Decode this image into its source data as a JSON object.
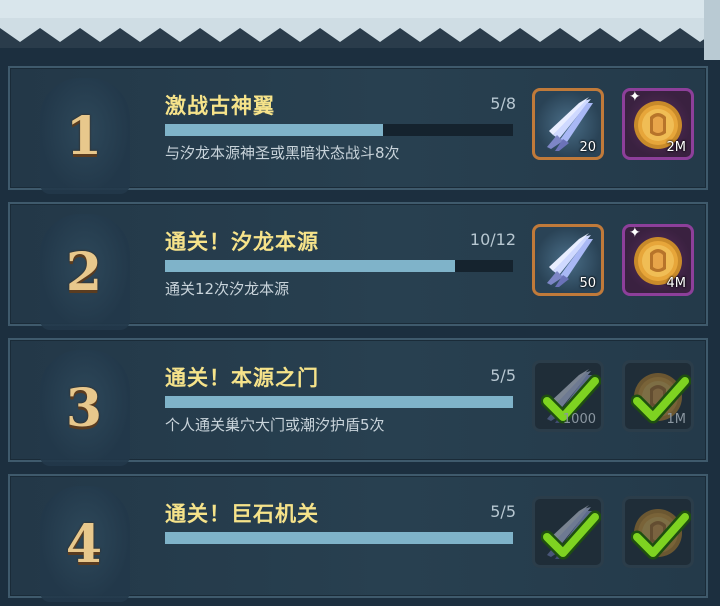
{
  "quests": [
    {
      "rank": "1",
      "title": "激战古神翼",
      "progress": "5/8",
      "progress_fraction": 0.625,
      "description": "与汐龙本源神圣或黑暗状态战斗8次",
      "completed": false,
      "rewards": [
        {
          "icon": "crystal-shard-icon",
          "qty": "20",
          "frame": "orange"
        },
        {
          "icon": "gold-coin-icon",
          "qty": "2M",
          "frame": "purple"
        }
      ]
    },
    {
      "rank": "2",
      "title": "通关！汐龙本源",
      "progress": "10/12",
      "progress_fraction": 0.833,
      "description": "通关12次汐龙本源",
      "completed": false,
      "rewards": [
        {
          "icon": "crystal-shard-icon",
          "qty": "50",
          "frame": "orange"
        },
        {
          "icon": "gold-coin-icon",
          "qty": "4M",
          "frame": "purple"
        }
      ]
    },
    {
      "rank": "3",
      "title": "通关！本源之门",
      "progress": "5/5",
      "progress_fraction": 1.0,
      "description": "个人通关巢穴大门或潮汐护盾5次",
      "completed": true,
      "rewards": [
        {
          "icon": "crystal-shard-icon",
          "qty": "1000",
          "frame": "done"
        },
        {
          "icon": "gold-coin-icon",
          "qty": "1M",
          "frame": "done"
        }
      ]
    },
    {
      "rank": "4",
      "title": "通关！巨石机关",
      "progress": "5/5",
      "progress_fraction": 1.0,
      "description": "",
      "completed": true,
      "rewards": [
        {
          "icon": "crystal-shard-icon",
          "qty": "",
          "frame": "done"
        },
        {
          "icon": "gold-coin-icon",
          "qty": "",
          "frame": "done"
        }
      ]
    }
  ],
  "colors": {
    "title": "#f6e38a",
    "bar_fill": "#7fb3c9",
    "check": "#7ed321"
  }
}
